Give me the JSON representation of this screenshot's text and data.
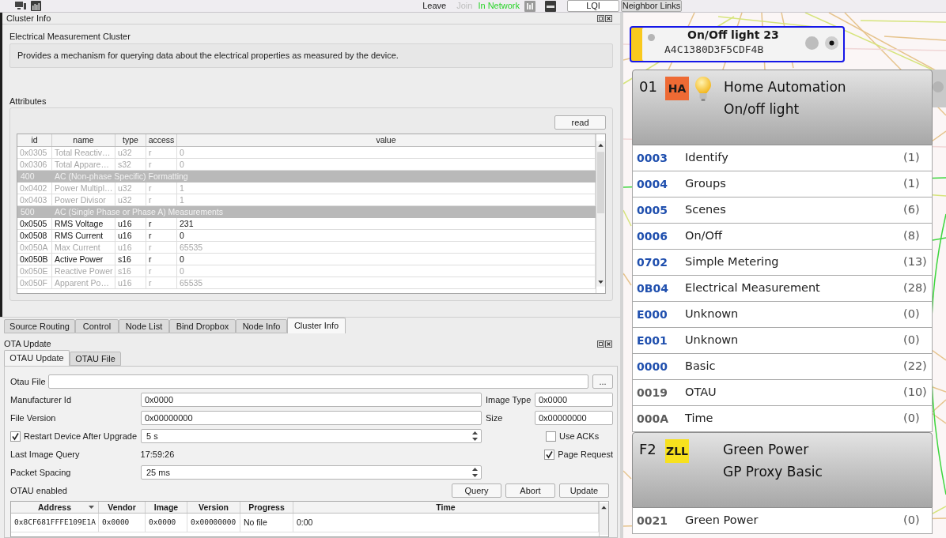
{
  "toolbar": {
    "network_actions": [
      {
        "label": "Leave",
        "disabled": false
      },
      {
        "label": "Join",
        "disabled": true
      }
    ],
    "network_status": "In Network",
    "view_buttons": [
      {
        "label": "LQI",
        "checked": false
      },
      {
        "label": "Neighbor Links",
        "checked": true
      }
    ]
  },
  "cluster_info": {
    "title": "Cluster Info",
    "cluster_name": "Electrical Measurement Cluster",
    "description": "Provides a mechanism for querying data about the electrical properties as measured by the device.",
    "attributes_label": "Attributes",
    "read_button": "read",
    "table": {
      "columns": [
        "id",
        "name",
        "type",
        "access",
        "value"
      ],
      "rows": [
        {
          "kind": "attribute",
          "id": "0x0305",
          "name": "Total Reactiv…",
          "type": "u32",
          "access": "r",
          "value": "0",
          "disabled": true
        },
        {
          "kind": "attribute",
          "id": "0x0306",
          "name": "Total Appare…",
          "type": "s32",
          "access": "r",
          "value": "0",
          "disabled": true
        },
        {
          "kind": "section",
          "id": "400",
          "name": "AC (Non-phase Specific) Formatting"
        },
        {
          "kind": "attribute",
          "id": "0x0402",
          "name": "Power Multipl…",
          "type": "u32",
          "access": "r",
          "value": "1",
          "disabled": true
        },
        {
          "kind": "attribute",
          "id": "0x0403",
          "name": "Power Divisor",
          "type": "u32",
          "access": "r",
          "value": "1",
          "disabled": true
        },
        {
          "kind": "section",
          "id": "500",
          "name": "AC (Single Phase or Phase A) Measurements"
        },
        {
          "kind": "attribute",
          "id": "0x0505",
          "name": "RMS Voltage",
          "type": "u16",
          "access": "r",
          "value": "231",
          "disabled": false
        },
        {
          "kind": "attribute",
          "id": "0x0508",
          "name": "RMS Current",
          "type": "u16",
          "access": "r",
          "value": "0",
          "disabled": false
        },
        {
          "kind": "attribute",
          "id": "0x050A",
          "name": "Max Current",
          "type": "u16",
          "access": "r",
          "value": "65535",
          "disabled": true
        },
        {
          "kind": "attribute",
          "id": "0x050B",
          "name": "Active Power",
          "type": "s16",
          "access": "r",
          "value": "0",
          "disabled": false
        },
        {
          "kind": "attribute",
          "id": "0x050E",
          "name": "Reactive Power",
          "type": "s16",
          "access": "r",
          "value": "0",
          "disabled": true
        },
        {
          "kind": "attribute",
          "id": "0x050F",
          "name": "Apparent Po…",
          "type": "u16",
          "access": "r",
          "value": "65535",
          "disabled": true
        }
      ]
    }
  },
  "dock_tabs": [
    {
      "label": "Source Routing",
      "selected": false
    },
    {
      "label": "Control",
      "selected": false
    },
    {
      "label": "Node List",
      "selected": false
    },
    {
      "label": "Bind Dropbox",
      "selected": false
    },
    {
      "label": "Node Info",
      "selected": false
    },
    {
      "label": "Cluster Info",
      "selected": true
    }
  ],
  "ota_update": {
    "title": "OTA Update",
    "tabs": [
      {
        "label": "OTAU Update",
        "selected": true
      },
      {
        "label": "OTAU File",
        "selected": false
      }
    ],
    "otau_file": {
      "label": "Otau File"
    },
    "browse_button": "...",
    "manufacturer_id": {
      "label": "Manufacturer Id",
      "value": "0x0000"
    },
    "image_type": {
      "label": "Image Type",
      "value": "0x0000"
    },
    "file_version": {
      "label": "File Version",
      "value": "0x00000000"
    },
    "size": {
      "label": "Size",
      "value": "0x00000000"
    },
    "restart_device": {
      "label": "Restart Device After Upgrade",
      "checked": true,
      "value": "5 s"
    },
    "use_acks": {
      "label": "Use ACKs",
      "checked": false
    },
    "last_image_query": {
      "label": "Last Image Query",
      "value": "17:59:26"
    },
    "page_request": {
      "label": "Page Request",
      "checked": true
    },
    "packet_spacing": {
      "label": "Packet Spacing",
      "value": "25 ms"
    },
    "status": "OTAU enabled",
    "buttons": [
      "Query",
      "Abort",
      "Update"
    ],
    "table": {
      "columns": [
        {
          "label": "Address",
          "sorted": true
        },
        {
          "label": "Vendor",
          "sorted": false
        },
        {
          "label": "Image",
          "sorted": false
        },
        {
          "label": "Version",
          "sorted": false
        },
        {
          "label": "Progress",
          "sorted": false
        },
        {
          "label": "Time",
          "sorted": false
        }
      ],
      "rows": [
        [
          "0x8CF681FFFE109E1A",
          "0x0000",
          "0x0000",
          "0x00000000",
          "No file",
          "0:00"
        ]
      ]
    }
  },
  "node": {
    "name": "On/Off light 23",
    "address": "A4C1380D3F5CDF4B",
    "selected": true
  },
  "endpoints": [
    {
      "endpoint": "01",
      "profile": "HA",
      "color": "#ee6a34",
      "device_icon": true,
      "profile_name": "Home Automation",
      "device_name": "On/off light",
      "clusters": [
        {
          "id": "0003",
          "name": "Identify",
          "count": "(1)",
          "kind": "server"
        },
        {
          "id": "0004",
          "name": "Groups",
          "count": "(1)",
          "kind": "server"
        },
        {
          "id": "0005",
          "name": "Scenes",
          "count": "(6)",
          "kind": "server"
        },
        {
          "id": "0006",
          "name": "On/Off",
          "count": "(8)",
          "kind": "server"
        },
        {
          "id": "0702",
          "name": "Simple Metering",
          "count": "(13)",
          "kind": "server"
        },
        {
          "id": "0B04",
          "name": "Electrical Measurement",
          "count": "(28)",
          "kind": "server"
        },
        {
          "id": "E000",
          "name": "Unknown",
          "count": "(0)",
          "kind": "server"
        },
        {
          "id": "E001",
          "name": "Unknown",
          "count": "(0)",
          "kind": "server"
        },
        {
          "id": "0000",
          "name": "Basic",
          "count": "(22)",
          "kind": "server"
        },
        {
          "id": "0019",
          "name": "OTAU",
          "count": "(10)",
          "kind": "client"
        },
        {
          "id": "000A",
          "name": "Time",
          "count": "(0)",
          "kind": "client"
        }
      ]
    },
    {
      "endpoint": "F2",
      "profile": "ZLL",
      "color": "#f7e11e",
      "device_icon": false,
      "profile_name": "Green Power",
      "device_name": "GP Proxy Basic",
      "clusters": [
        {
          "id": "0021",
          "name": "Green Power",
          "count": "(0)",
          "kind": "client"
        }
      ]
    }
  ]
}
